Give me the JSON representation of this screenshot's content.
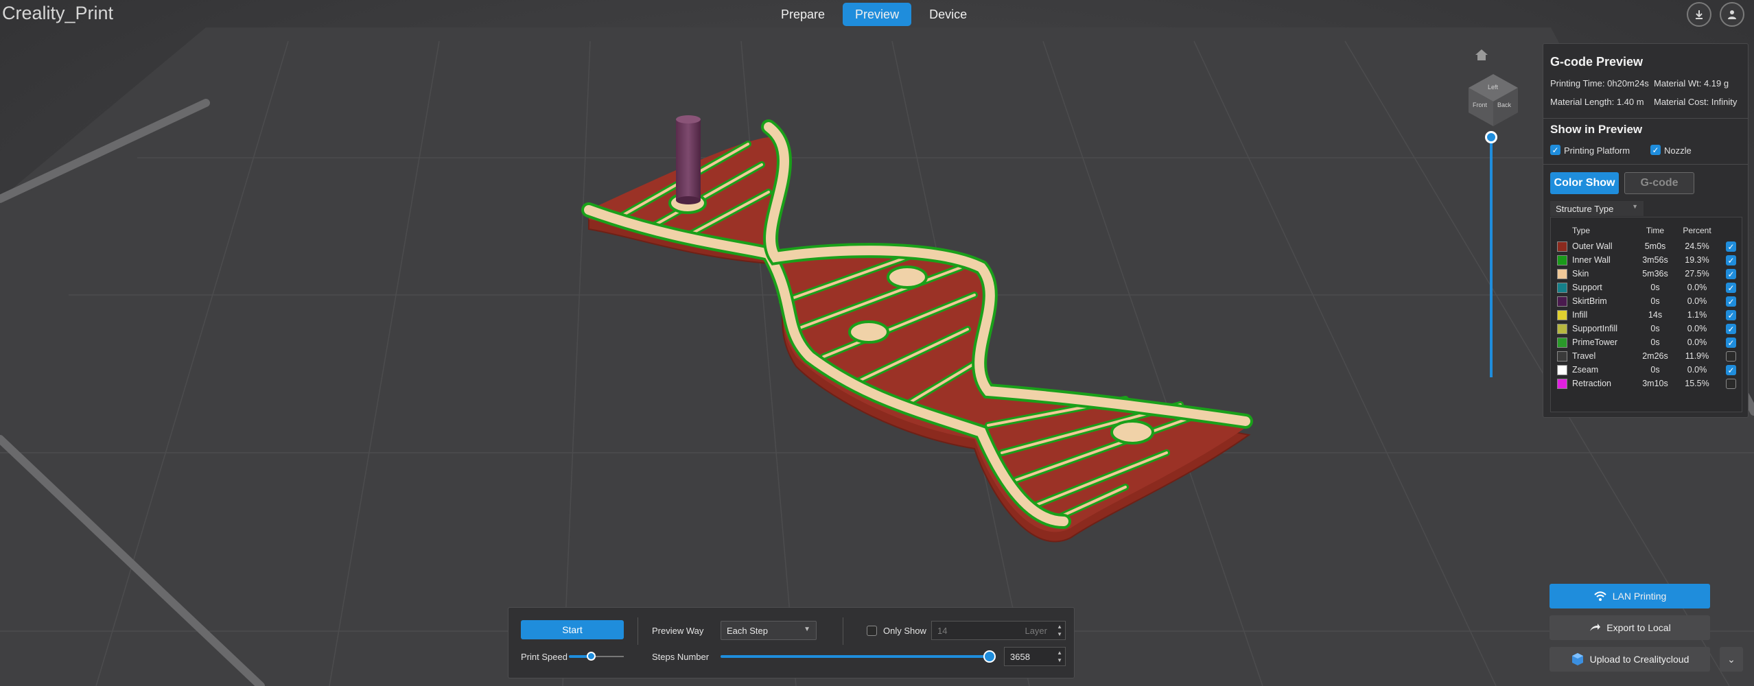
{
  "app": {
    "title": "Creality_Print"
  },
  "nav": {
    "tabs": [
      {
        "label": "Prepare"
      },
      {
        "label": "Preview"
      },
      {
        "label": "Device"
      }
    ],
    "active": "Preview"
  },
  "topbar": {
    "download_icon": "download-icon",
    "account_icon": "user-icon"
  },
  "gcode_panel": {
    "title": "G-code Preview",
    "printing_time": "Printing Time: 0h20m24s",
    "material_wt": "Material Wt: 4.19 g",
    "material_length": "Material Length: 1.40 m",
    "material_cost": "Material Cost: Infinity",
    "show_title": "Show in Preview",
    "printing_platform": {
      "label": "Printing Platform",
      "checked": true
    },
    "nozzle": {
      "label": "Nozzle",
      "checked": true
    },
    "color_show_label": "Color Show",
    "gcode_label": "G-code",
    "structure_select": "Structure Type",
    "legend": {
      "headers": {
        "type": "Type",
        "time": "Time",
        "percent": "Percent"
      },
      "rows": [
        {
          "type": "Outer Wall",
          "time": "5m0s",
          "percent": "24.5%",
          "color": "#8b2a1e",
          "checked": true
        },
        {
          "type": "Inner Wall",
          "time": "3m56s",
          "percent": "19.3%",
          "color": "#1a9a1a",
          "checked": true
        },
        {
          "type": "Skin",
          "time": "5m36s",
          "percent": "27.5%",
          "color": "#f0c898",
          "checked": true
        },
        {
          "type": "Support",
          "time": "0s",
          "percent": "0.0%",
          "color": "#16808a",
          "checked": true
        },
        {
          "type": "SkirtBrim",
          "time": "0s",
          "percent": "0.0%",
          "color": "#4a1a4e",
          "checked": true
        },
        {
          "type": "Infill",
          "time": "14s",
          "percent": "1.1%",
          "color": "#e0d030",
          "checked": true
        },
        {
          "type": "SupportInfill",
          "time": "0s",
          "percent": "0.0%",
          "color": "#b8b840",
          "checked": true
        },
        {
          "type": "PrimeTower",
          "time": "0s",
          "percent": "0.0%",
          "color": "#2a9a2a",
          "checked": true
        },
        {
          "type": "Travel",
          "time": "2m26s",
          "percent": "11.9%",
          "color": "#3a3a3a",
          "checked": false
        },
        {
          "type": "Zseam",
          "time": "0s",
          "percent": "0.0%",
          "color": "#ffffff",
          "checked": true
        },
        {
          "type": "Retraction",
          "time": "3m10s",
          "percent": "15.5%",
          "color": "#e020e0",
          "checked": false
        }
      ]
    }
  },
  "bottom_panel": {
    "start_label": "Start",
    "print_speed_label": "Print Speed",
    "print_speed_level": 0.4,
    "preview_way_label": "Preview Way",
    "preview_way_value": "Each Step",
    "only_show_label": "Only Show",
    "only_show_checked": false,
    "layer_value": "14",
    "layer_unit": "Layer",
    "steps_number_label": "Steps Number",
    "steps_value": "3658",
    "steps_level": 1.0
  },
  "actions": {
    "lan_printing": "LAN Printing",
    "export_local": "Export to Local",
    "upload_cloud": "Upload to Crealitycloud"
  },
  "layer_slider": {
    "level": 1.0
  },
  "view_cube": {
    "faces": [
      "Left",
      "Front",
      "Back"
    ]
  },
  "colors": {
    "accent": "#1f8ddc",
    "outer_wall": "#8b2a1e",
    "inner_wall": "#1a9a1a",
    "skin": "#f0c898",
    "nozzle": "#6a3a5a"
  }
}
